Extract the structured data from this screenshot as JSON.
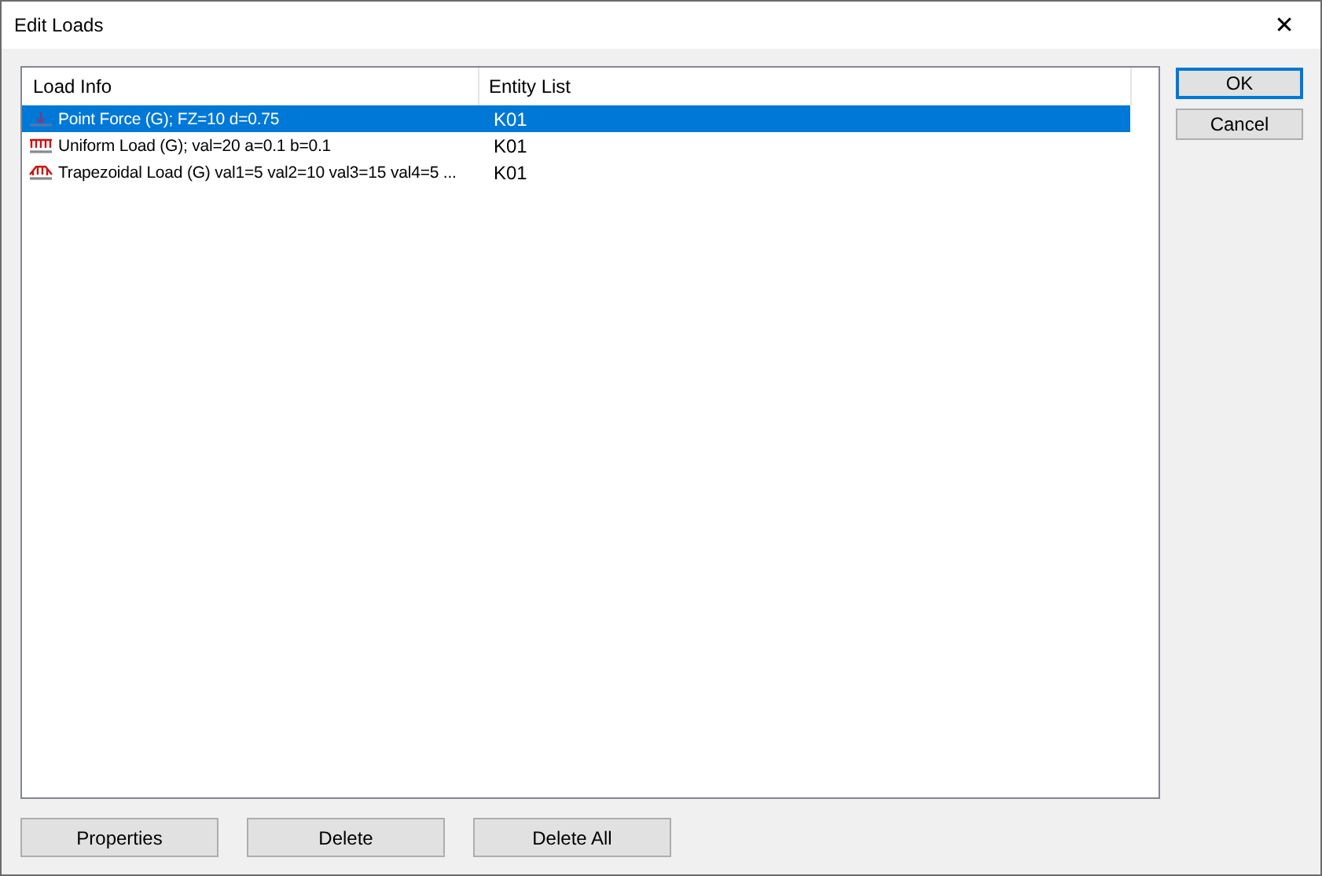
{
  "window": {
    "title": "Edit Loads",
    "close": "✕"
  },
  "table": {
    "columns": [
      "Load Info",
      "Entity List"
    ],
    "rows": [
      {
        "kind": "point",
        "load_info": "Point Force (G); FZ=10 d=0.75",
        "entity_list": "K01",
        "selected": true
      },
      {
        "kind": "uniform",
        "load_info": "Uniform Load (G); val=20 a=0.1 b=0.1",
        "entity_list": "K01",
        "selected": false
      },
      {
        "kind": "trapezoidal",
        "load_info": "Trapezoidal Load (G) val1=5 val2=10 val3=15 val4=5 ...",
        "entity_list": "K01",
        "selected": false
      }
    ]
  },
  "side_buttons": [
    {
      "label": "OK",
      "default": true
    },
    {
      "label": "Cancel",
      "default": false
    }
  ],
  "bottom_buttons": [
    "Properties",
    "Delete",
    "Delete All"
  ]
}
